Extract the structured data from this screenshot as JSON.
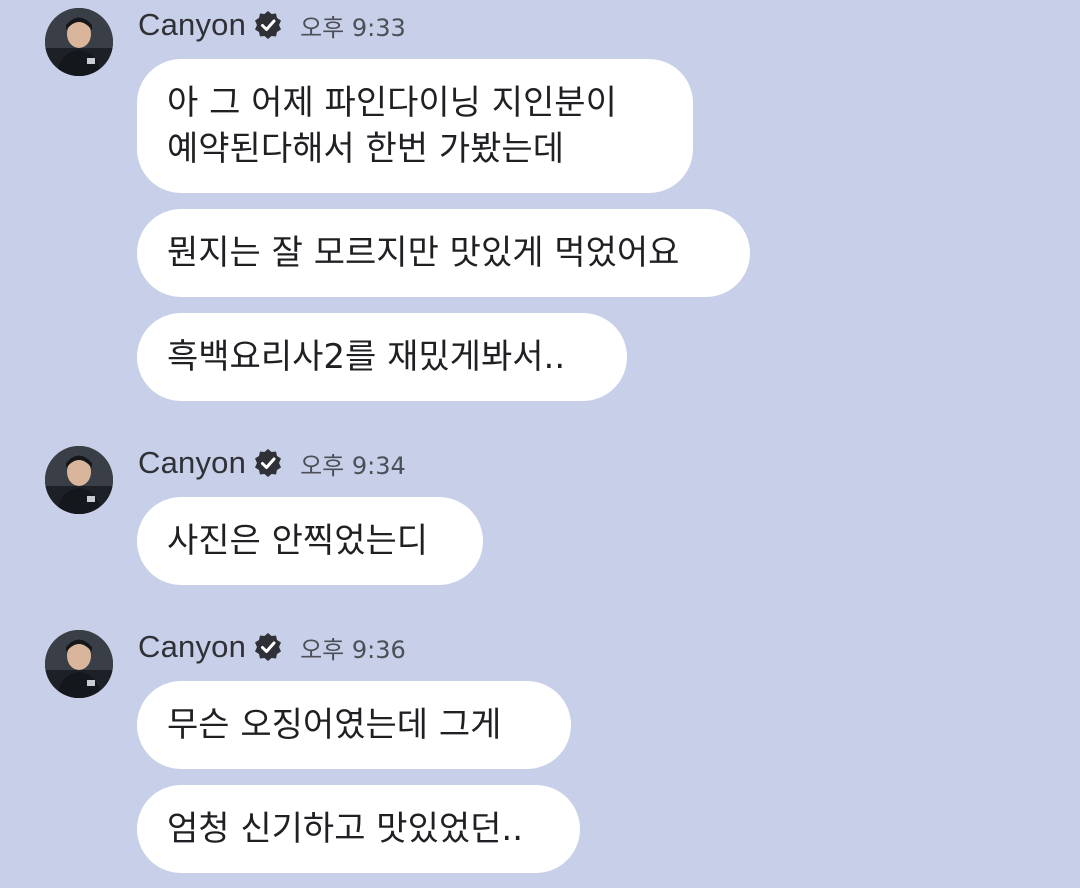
{
  "groups": [
    {
      "sender": "Canyon",
      "time": "오후 9:33",
      "messages": [
        {
          "lines": [
            "아 그 어제 파인다이닝 지인분이",
            "예약된다해서 한번 가봤는데"
          ]
        },
        {
          "lines": [
            "뭔지는 잘 모르지만 맛있게 먹었어요"
          ]
        },
        {
          "lines": [
            "흑백요리사2를 재밌게봐서.."
          ]
        }
      ]
    },
    {
      "sender": "Canyon",
      "time": "오후 9:34",
      "messages": [
        {
          "lines": [
            "사진은 안찍었는디"
          ]
        }
      ]
    },
    {
      "sender": "Canyon",
      "time": "오후 9:36",
      "messages": [
        {
          "lines": [
            "무슨 오징어였는데 그게"
          ]
        },
        {
          "lines": [
            "엄청 신기하고 맛있었던.."
          ]
        }
      ]
    }
  ],
  "colors": {
    "background": "#c8cfe8",
    "bubble": "#ffffff",
    "text": "#1f2023",
    "name": "#2f3136",
    "verified_badge": "#2f3136"
  },
  "icons": {
    "verified": "verified-badge-icon",
    "avatar": "profile-photo"
  }
}
